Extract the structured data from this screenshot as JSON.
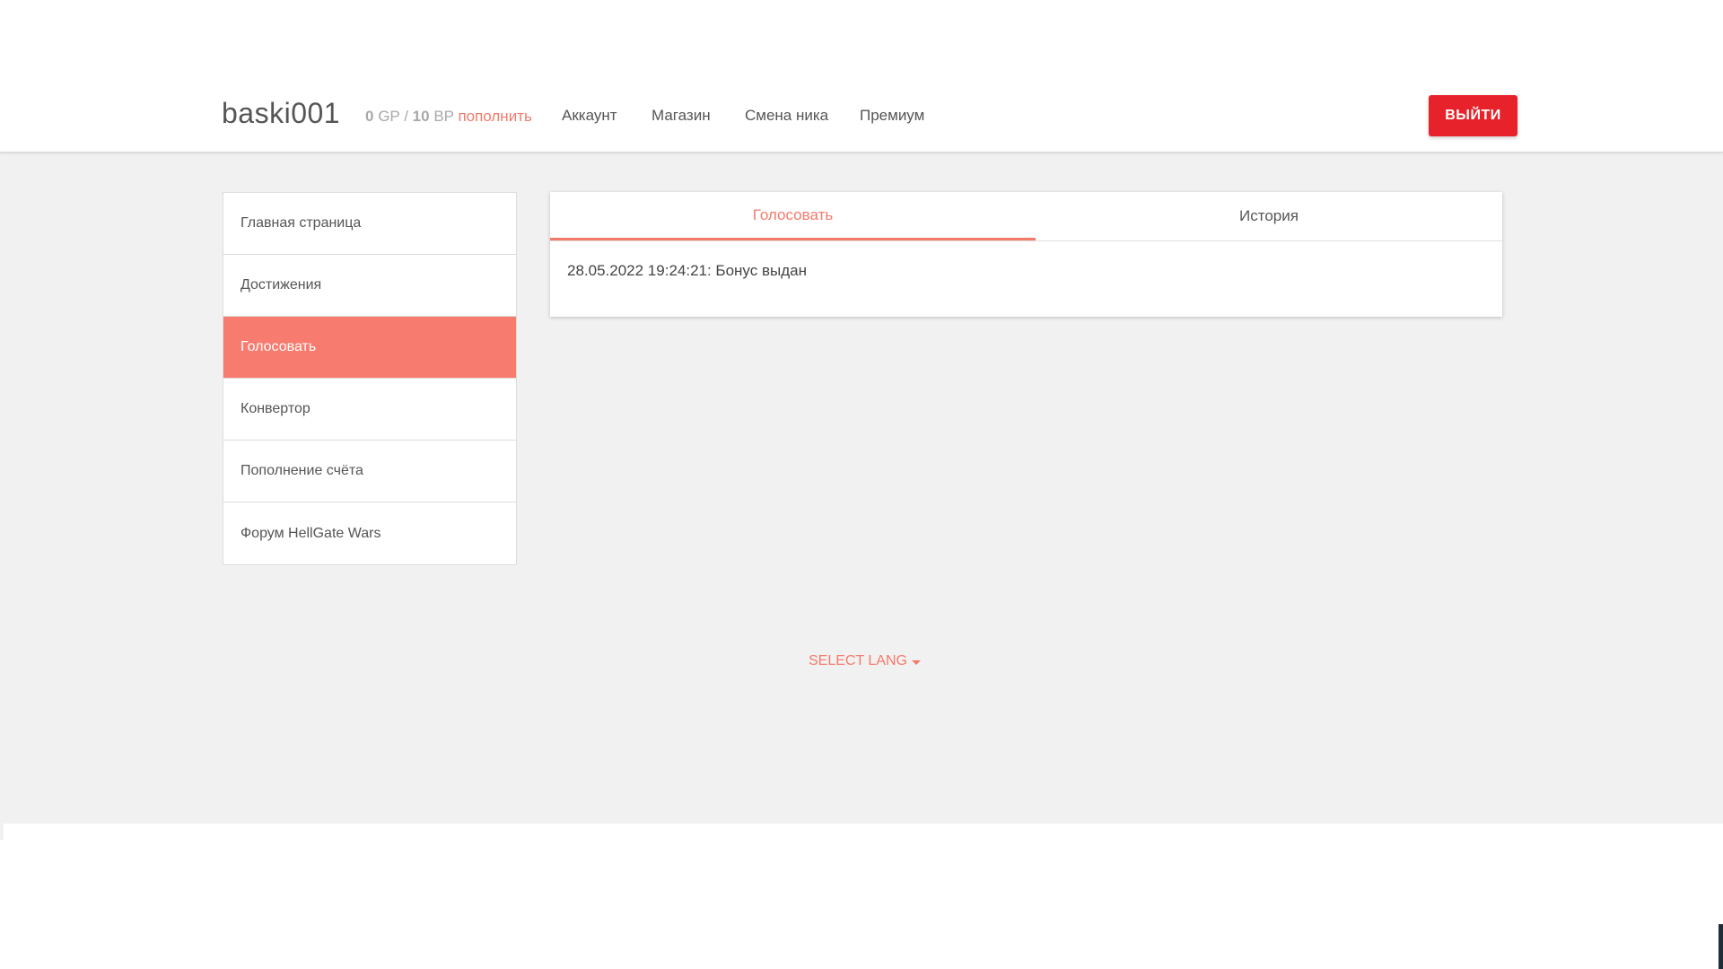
{
  "header": {
    "username": "baski001",
    "balance": {
      "gp_value": "0",
      "gp_label": "GP",
      "separator": "/",
      "bp_value": "10",
      "bp_label": "BP",
      "topup_label": "пополнить"
    },
    "nav": [
      {
        "label": "Аккаунт"
      },
      {
        "label": "Магазин"
      },
      {
        "label": "Смена ника"
      },
      {
        "label": "Премиум"
      }
    ],
    "logout_label": "ВЫЙТИ"
  },
  "sidebar": {
    "items": [
      {
        "label": "Главная страница",
        "active": false
      },
      {
        "label": "Достижения",
        "active": false
      },
      {
        "label": "Голосовать",
        "active": true
      },
      {
        "label": "Конвертор",
        "active": false
      },
      {
        "label": "Пополнение счёта",
        "active": false
      },
      {
        "label": "Форум HellGate Wars",
        "active": false
      }
    ]
  },
  "panel": {
    "tabs": [
      {
        "label": "Голосовать",
        "active": true
      },
      {
        "label": "История",
        "active": false
      }
    ],
    "entry": "28.05.2022 19:24:21: Бонус выдан"
  },
  "footer": {
    "lang_label": "SELECT LANG"
  },
  "colors": {
    "accent": "#f47a6b",
    "logout": "#e8222b",
    "background": "#f1f1f1"
  }
}
